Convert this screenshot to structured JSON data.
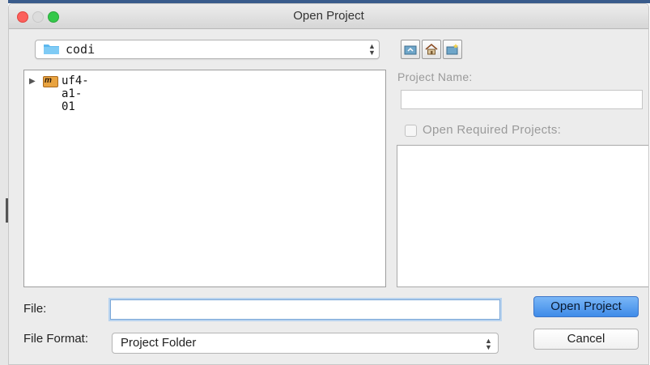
{
  "window": {
    "title": "Open Project"
  },
  "toolbar": {
    "directory_label": "codi",
    "icons": [
      "folder-icon",
      "up-folder-icon",
      "home-icon",
      "new-folder-icon"
    ]
  },
  "tree": {
    "items": [
      {
        "label": "uf4-a1-01",
        "icon": "maven-project-icon",
        "badge": "m"
      }
    ]
  },
  "project": {
    "name_label": "Project Name:",
    "name_value": "",
    "open_required_label": "Open Required Projects:"
  },
  "bottom": {
    "file_label": "File:",
    "file_value": "",
    "format_label": "File Format:",
    "format_value": "Project Folder",
    "open_button": "Open Project",
    "cancel_button": "Cancel"
  },
  "colors": {
    "primary_button": "#3f8be8",
    "close_light": "#fc605c",
    "zoom_light": "#34c84a",
    "focus_ring": "#7aa7d8"
  }
}
